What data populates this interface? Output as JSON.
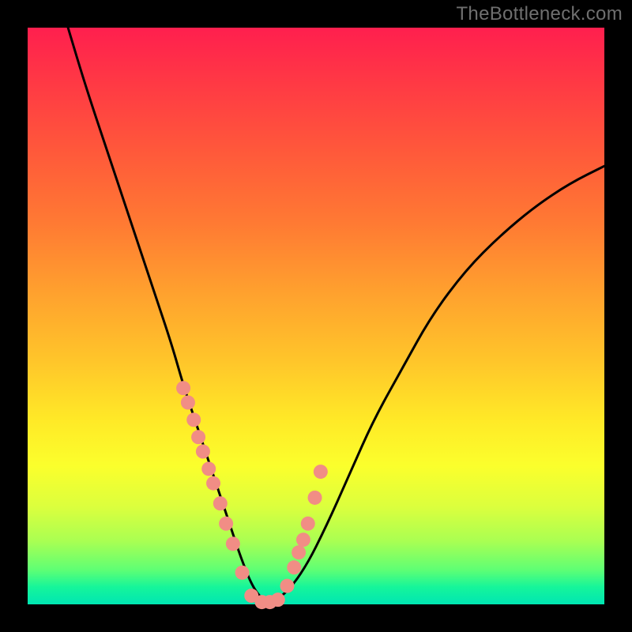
{
  "watermark": "TheBottleneck.com",
  "colors": {
    "curve_stroke": "#000000",
    "dot_fill": "#f18d85",
    "dot_stroke": "#d47067",
    "plot_left": 35,
    "plot_top": 35,
    "plot_size": 730
  },
  "chart_data": {
    "type": "line",
    "title": "",
    "xlabel": "",
    "ylabel": "",
    "xlim": [
      0,
      100
    ],
    "ylim": [
      0,
      100
    ],
    "note": "Axes are implicit (no tick labels rendered). Values are estimated percentages of the plot area; y increases upward.",
    "series": [
      {
        "name": "curve",
        "kind": "line",
        "x": [
          7,
          10,
          14,
          18,
          22,
          25,
          27,
          29,
          31,
          33,
          35,
          37,
          39,
          41,
          44,
          48,
          52,
          56,
          60,
          65,
          70,
          76,
          82,
          88,
          94,
          100
        ],
        "y": [
          100,
          90,
          78,
          66,
          54,
          45,
          38,
          32,
          26,
          20,
          14,
          8,
          3,
          0.5,
          1,
          6,
          14,
          23,
          32,
          41,
          50,
          58,
          64,
          69,
          73,
          76
        ]
      },
      {
        "name": "dots",
        "kind": "scatter",
        "x": [
          27.0,
          27.8,
          28.8,
          29.6,
          30.4,
          31.4,
          32.2,
          33.4,
          34.4,
          35.6,
          37.2,
          38.8,
          40.6,
          42.0,
          43.4,
          45.0,
          46.2,
          47.0,
          47.8,
          48.6,
          49.8,
          50.8
        ],
        "y": [
          37.5,
          35.0,
          32.0,
          29.0,
          26.5,
          23.5,
          21.0,
          17.5,
          14.0,
          10.5,
          5.5,
          1.5,
          0.4,
          0.4,
          0.8,
          3.2,
          6.4,
          9.0,
          11.2,
          14.0,
          18.5,
          23.0
        ]
      }
    ]
  }
}
